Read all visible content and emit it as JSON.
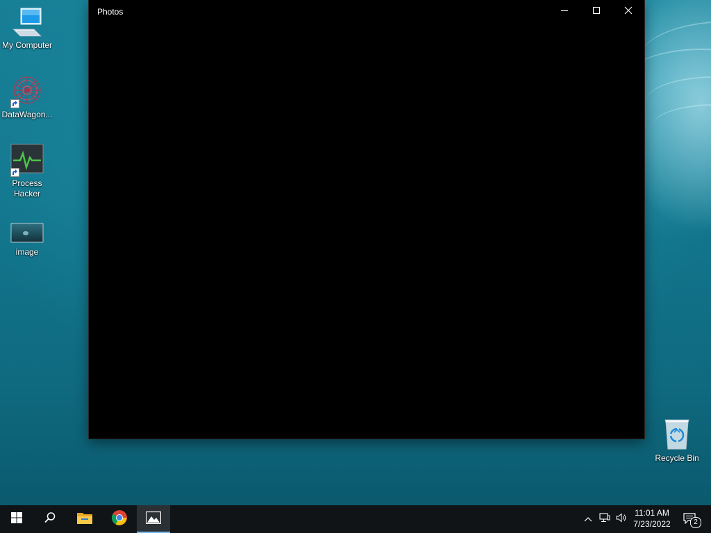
{
  "desktop": {
    "icons": [
      {
        "label": "My Computer",
        "icon": "computer-icon"
      },
      {
        "label": "DataWagon...",
        "icon": "datawagon-icon"
      },
      {
        "label": "Process Hacker",
        "icon": "process-hacker-icon"
      },
      {
        "label": "image",
        "icon": "image-file-icon"
      },
      {
        "label": "Recycle Bin",
        "icon": "recycle-bin-icon"
      }
    ]
  },
  "window": {
    "title": "Photos",
    "buttons": [
      "minimize-icon",
      "maximize-icon",
      "close-icon"
    ]
  },
  "taskbar": {
    "items": [
      "windows-start-icon",
      "search-icon",
      "file-explorer-icon",
      "chrome-icon",
      "photos-icon"
    ],
    "active_item": "photos-icon",
    "tray": {
      "icons": [
        "chevron-up-icon",
        "network-icon",
        "volume-icon"
      ],
      "time": "11:01 AM",
      "date": "7/23/2022",
      "notification_count": "2"
    }
  },
  "colors": {
    "taskbar_bg": "#101417",
    "active_indicator": "#76b9ed",
    "desktop_teal": "#177f96"
  }
}
